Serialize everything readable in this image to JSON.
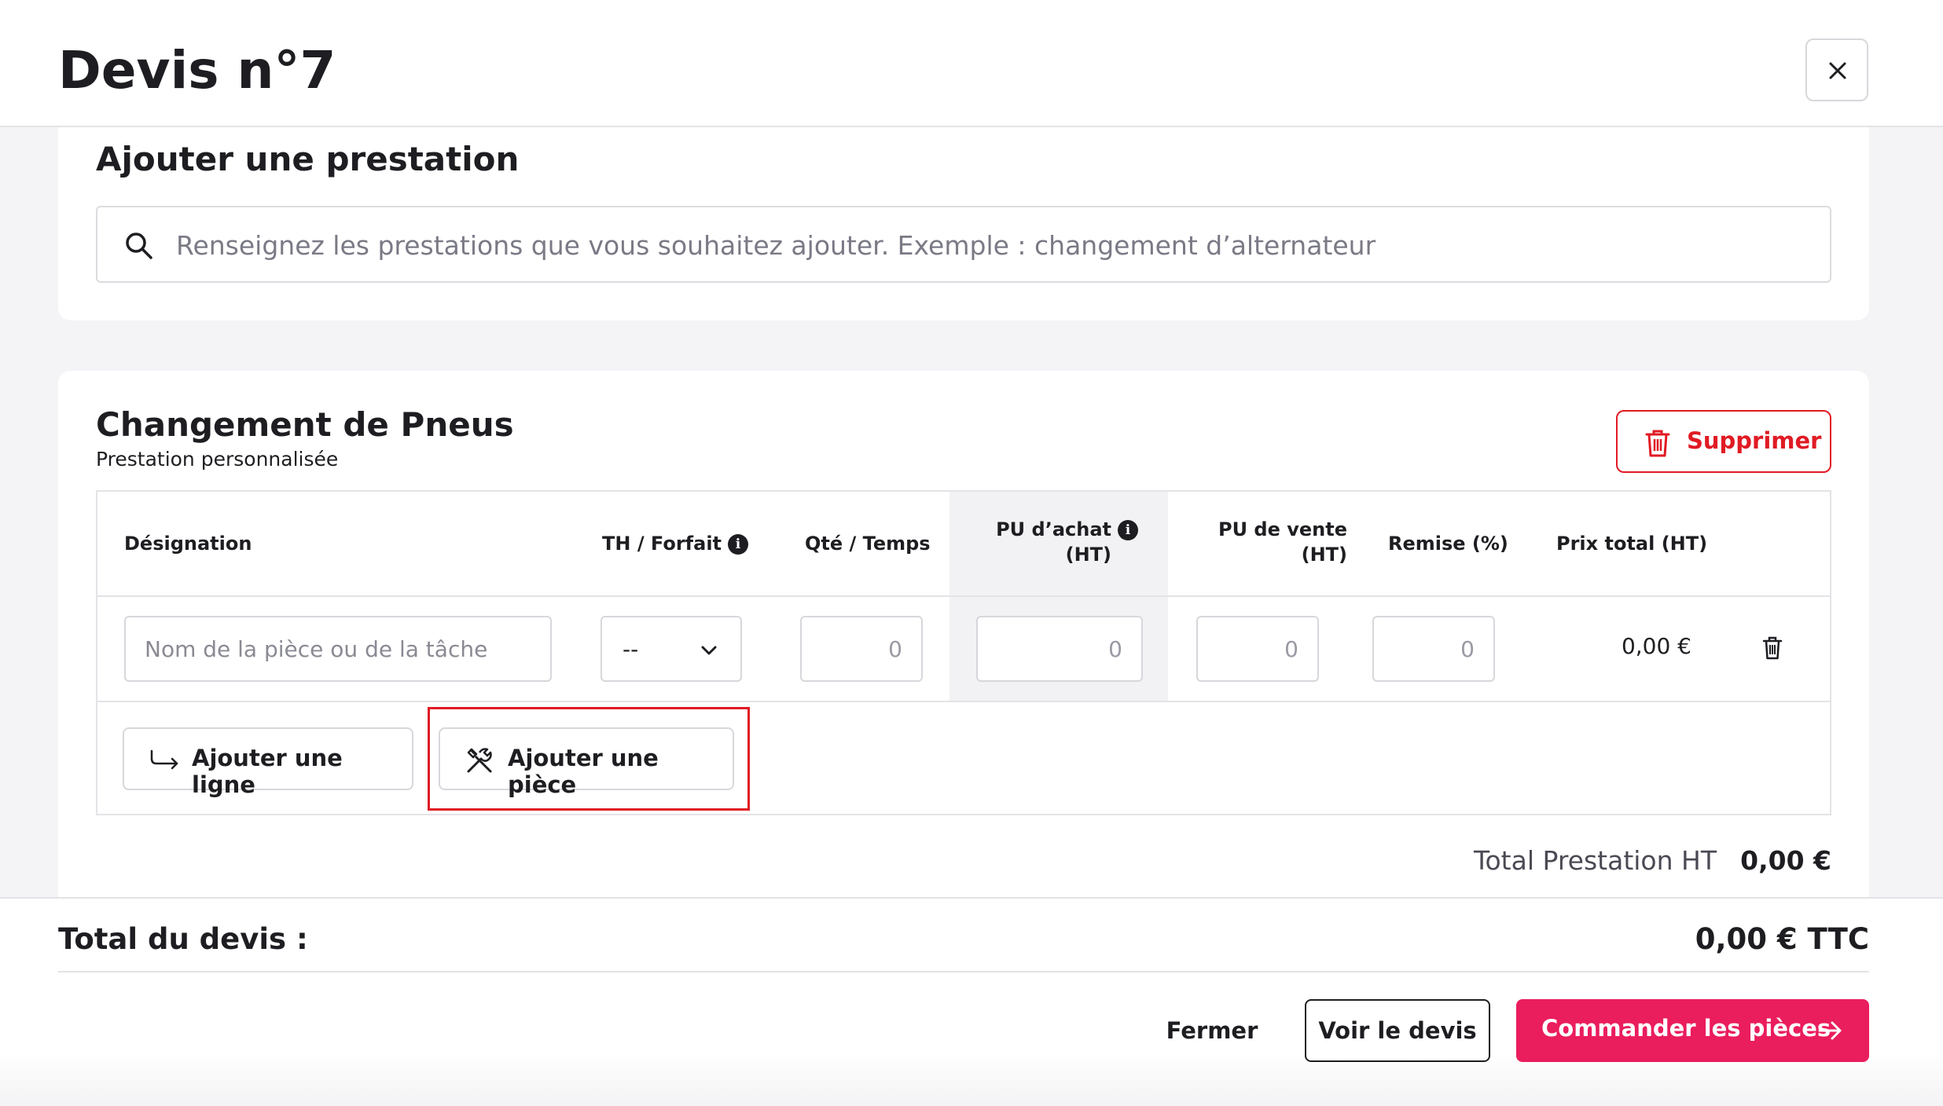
{
  "header": {
    "title": "Devis n°7",
    "close_icon": "close-icon"
  },
  "add_prestation": {
    "title": "Ajouter une prestation",
    "search_placeholder": "Renseignez les prestations que vous souhaitez ajouter. Exemple : changement d’alternateur"
  },
  "prestation": {
    "title": "Changement de Pneus",
    "subtitle": "Prestation personnalisée",
    "delete_label": "Supprimer",
    "columns": {
      "designation": "Désignation",
      "th_forfait": "TH / Forfait",
      "qte_temps": "Qté / Temps",
      "pu_achat_1": "PU d’achat",
      "pu_achat_2": "(HT)",
      "pu_vente_1": "PU de vente",
      "pu_vente_2": "(HT)",
      "remise": "Remise (%)",
      "prix_total": "Prix total (HT)"
    },
    "row": {
      "designation_placeholder": "Nom de la pièce ou de la tâche",
      "th_forfait_value": "--",
      "qte_placeholder": "0",
      "pu_achat_placeholder": "0",
      "pu_vente_placeholder": "0",
      "remise_placeholder": "0",
      "prix_total": "0,00 €"
    },
    "add_line_label": "Ajouter une ligne",
    "add_piece_label": "Ajouter une pièce",
    "total_label": "Total Prestation HT",
    "total_value": "0,00 €"
  },
  "footer": {
    "total_label": "Total du devis :",
    "total_value": "0,00 € TTC",
    "fermer_label": "Fermer",
    "voir_label": "Voir le devis",
    "commander_label": "Commander les pièces"
  },
  "colors": {
    "accent": "#ea1d5d",
    "danger": "#e01b24",
    "text": "#1e1e22"
  }
}
